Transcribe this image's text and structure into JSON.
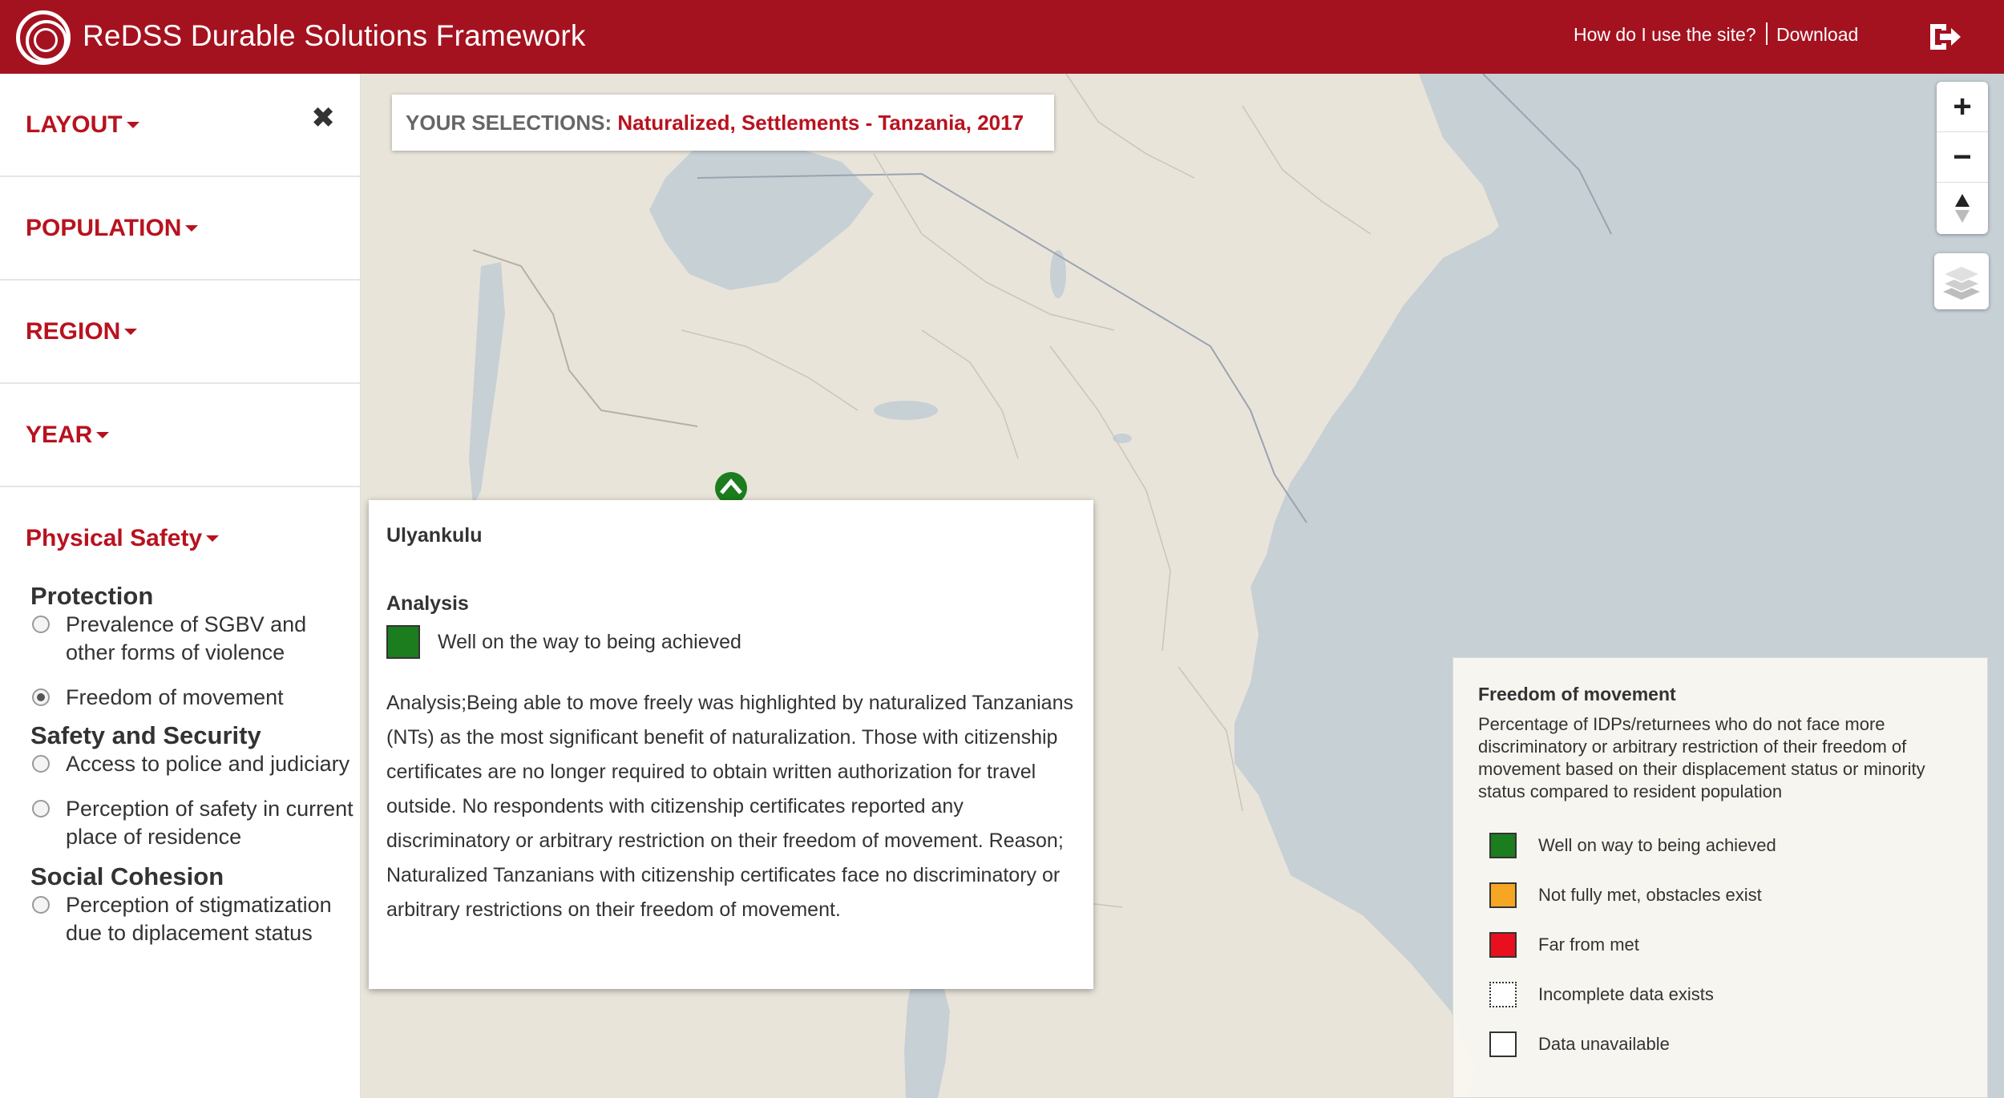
{
  "header": {
    "title": "ReDSS Durable Solutions Framework",
    "help_link": "How do I use the site?",
    "download_link": "Download",
    "logo_icon": "redss-logo-icon",
    "logout_icon": "logout-icon"
  },
  "sidebar": {
    "close_glyph": "✖",
    "sections": [
      {
        "label": "LAYOUT"
      },
      {
        "label": "POPULATION"
      },
      {
        "label": "REGION"
      },
      {
        "label": "YEAR"
      }
    ],
    "physical_safety": {
      "label": "Physical Safety",
      "categories": [
        {
          "title": "Protection",
          "options": [
            {
              "label": "Prevalence of SGBV and other forms of violence",
              "selected": false
            },
            {
              "label": "Freedom of movement",
              "selected": true
            }
          ]
        },
        {
          "title": "Safety and Security",
          "options": [
            {
              "label": "Access to police and judiciary",
              "selected": false
            },
            {
              "label": "Perception of safety in current place of residence",
              "selected": false
            }
          ]
        },
        {
          "title": "Social Cohesion",
          "options": [
            {
              "label": "Perception of stigmatization due to diplacement status",
              "selected": false
            }
          ]
        }
      ]
    }
  },
  "selections": {
    "label": "YOUR SELECTIONS:",
    "value": "Naturalized, Settlements - Tanzania, 2017"
  },
  "map_controls": {
    "zoom_in": "+",
    "zoom_out": "−",
    "compass_icon": "compass-icon",
    "layers_icon": "layers-icon"
  },
  "popup": {
    "title": "Ulyankulu",
    "analysis_heading": "Analysis",
    "status": "Well on the way to being achieved",
    "status_color": "#1b7d1e",
    "text": "Analysis;Being able to move freely was highlighted by naturalized Tanzanians (NTs) as the most significant benefit of naturalization. Those with citizenship certificates are no longer required to obtain written authorization for travel outside. No respondents with citizenship certificates reported any discriminatory or arbitrary restriction on their freedom of movement. Reason; Naturalized Tanzanians with citizenship certificates face no discriminatory or arbitrary restrictions on their freedom of movement."
  },
  "legend": {
    "title": "Freedom of movement",
    "description": "Percentage of IDPs/returnees who do not face more discriminatory or arbitrary restriction of their freedom of movement based on their displacement status or minority status compared to resident population",
    "items": [
      {
        "label": "Well on way to being achieved",
        "color": "#1b7d1e"
      },
      {
        "label": "Not fully met, obstacles exist",
        "color": "#f5a623"
      },
      {
        "label": "Far from met",
        "color": "#e8101f"
      },
      {
        "label": "Incomplete data exists",
        "color": "#ffffff"
      },
      {
        "label": "Data unavailable",
        "color": "#ffffff"
      }
    ]
  },
  "colors": {
    "brand": "#a4121f",
    "accent_text": "#b8121f",
    "water": "#c6d0d5",
    "land": "#e9e4da"
  }
}
